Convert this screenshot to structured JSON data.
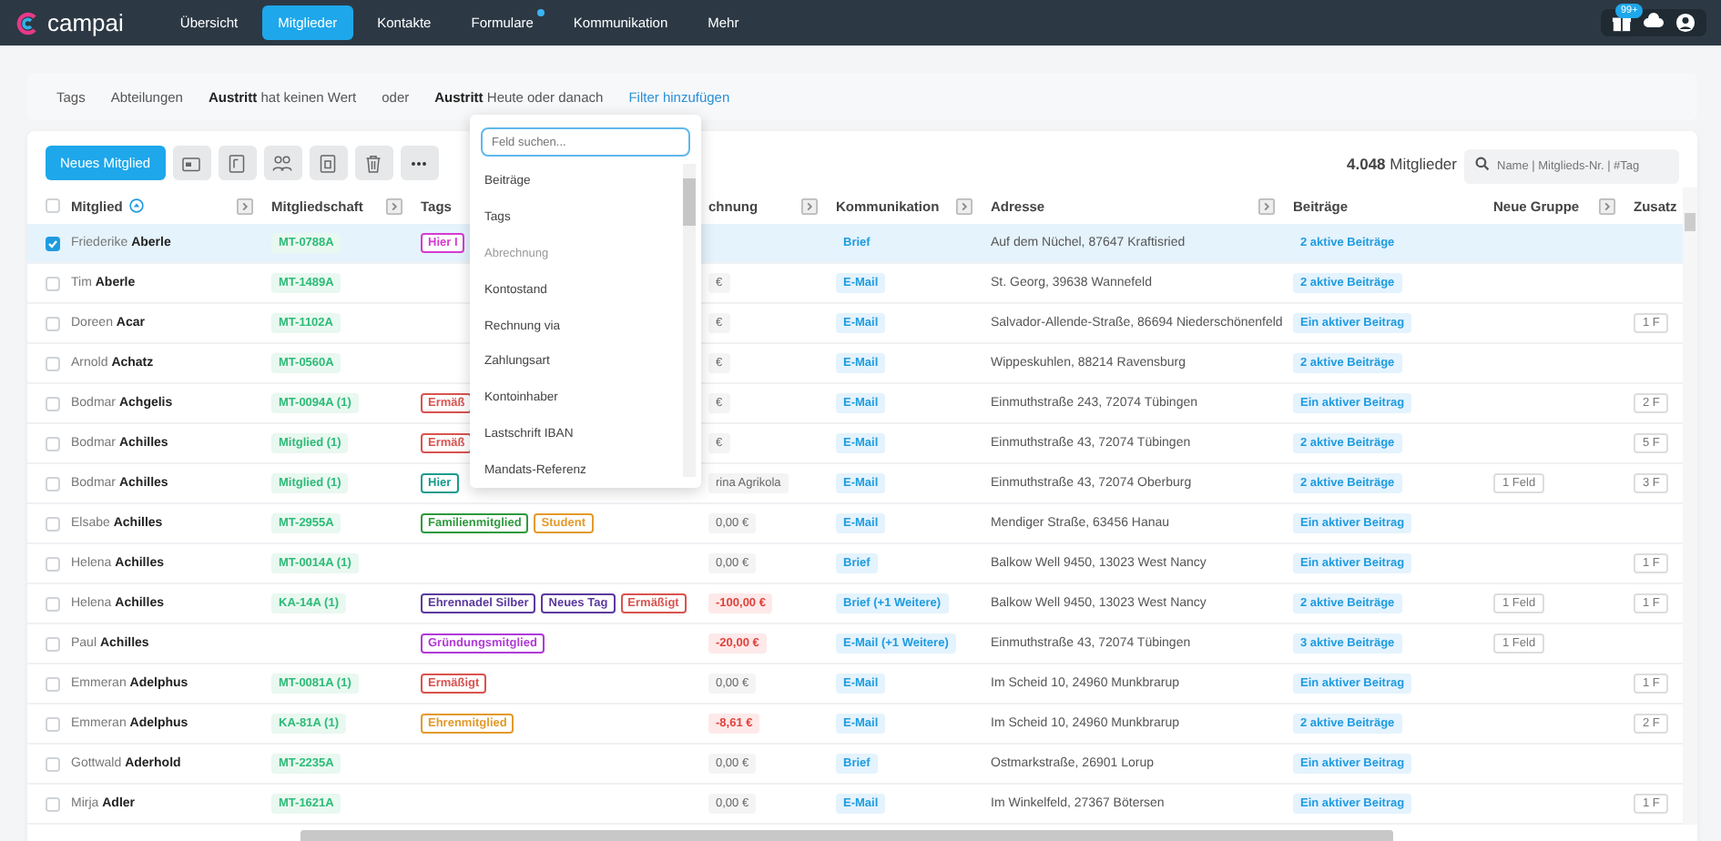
{
  "nav": {
    "logo": "campai",
    "items": [
      {
        "label": "Übersicht",
        "selected": false
      },
      {
        "label": "Mitglieder",
        "selected": true
      },
      {
        "label": "Kontakte",
        "selected": false
      },
      {
        "label": "Formulare",
        "selected": false,
        "dot": true
      },
      {
        "label": "Kommunikation",
        "selected": false
      },
      {
        "label": "Mehr",
        "selected": false
      }
    ],
    "badge": "99+"
  },
  "filters": [
    {
      "text": "Tags",
      "kind": "plain"
    },
    {
      "text": "Abteilungen",
      "kind": "plain"
    },
    {
      "text": "**Austritt** hat keinen Wert",
      "kind": "plain"
    },
    {
      "text": "oder",
      "kind": "plain"
    },
    {
      "text": "**Austritt** Heute oder danach",
      "kind": "plain"
    },
    {
      "text": "Filter hinzufügen",
      "kind": "link"
    }
  ],
  "toolbar": {
    "primary": "Neues Mitglied",
    "tools": [
      {
        "kind": "card"
      },
      {
        "kind": "form"
      },
      {
        "kind": "people"
      },
      {
        "kind": "number"
      },
      {
        "kind": "trash"
      },
      {
        "kind": "more"
      }
    ],
    "count": "**4.048** Mitglieder",
    "search_placeholder": "Name | Mitglieds-Nr. | #Tag"
  },
  "table": {
    "header_checked": false,
    "columns": [
      {
        "label": "Mitglied",
        "sorted": true,
        "expander": true
      },
      {
        "label": "Mitgliedschaft",
        "expander": true
      },
      {
        "label": "Tags"
      },
      {
        "label": "chnung",
        "expander": true
      },
      {
        "label": "Kommunikation",
        "expander": true
      },
      {
        "label": "Adresse",
        "expander": true
      },
      {
        "label": "Beiträge"
      },
      {
        "label": "Neue Gruppe",
        "expander": true
      },
      {
        "label": "Zusatz"
      }
    ],
    "rows": [
      {
        "selected": true,
        "name": "Friederike **Aberle**",
        "membership": "MT-0788A",
        "tags": [
          {
            "text": "Hier I",
            "color": "#d63bd0"
          }
        ],
        "comm": "Brief",
        "address": "Auf dem Nüchel, 87647 Kraftisried",
        "fees": "2 aktive Beiträge"
      },
      {
        "selected": false,
        "name": "Tim **Aberle**",
        "membership": "MT-1489A",
        "tags": [],
        "balance": "€",
        "comm": "E-Mail",
        "address": "St. Georg, 39638 Wannefeld",
        "fees": "2 aktive Beiträge"
      },
      {
        "selected": false,
        "name": "Doreen **Acar**",
        "membership": "MT-1102A",
        "tags": [],
        "balance": "€",
        "comm": "E-Mail",
        "address": "Salvador-Allende-Straße, 86694 Niederschönenfeld",
        "fees": "Ein aktiver Beitrag",
        "extra": "1 F"
      },
      {
        "selected": false,
        "name": "Arnold **Achatz**",
        "membership": "MT-0560A",
        "tags": [],
        "balance": "€",
        "comm": "E-Mail",
        "address": "Wippeskuhlen, 88214 Ravensburg",
        "fees": "2 aktive Beiträge"
      },
      {
        "selected": false,
        "name": "Bodmar **Achgelis**",
        "membership": "MT-0094A (1)",
        "tags": [
          {
            "text": "Ermäß",
            "color": "#d9534f"
          }
        ],
        "balance": "€",
        "comm": "E-Mail",
        "address": "Einmuthstraße 243, 72074 Tübingen",
        "fees": "Ein aktiver Beitrag",
        "extra": "2 F"
      },
      {
        "selected": false,
        "name": "Bodmar **Achilles**",
        "membership": "Mitglied (1)",
        "tags": [
          {
            "text": "Ermäß",
            "color": "#d9534f"
          }
        ],
        "balance": "€",
        "comm": "E-Mail",
        "address": "Einmuthstraße 43, 72074 Tübingen",
        "fees": "2 aktive Beiträge",
        "extra": "5 F"
      },
      {
        "selected": false,
        "name": "Bodmar **Achilles**",
        "membership": "Mitglied (1)",
        "tags": [
          {
            "text": "Hier",
            "color": "#1a9c8c"
          }
        ],
        "balance": "rina Agrikola",
        "comm": "E-Mail",
        "address": "Einmuthstraße 43, 72074 Oberburg",
        "fees": "2 aktive Beiträge",
        "group": "1 Feld",
        "extra": "3 F"
      },
      {
        "selected": false,
        "name": "Elsabe **Achilles**",
        "membership": "MT-2955A",
        "tags": [
          {
            "text": "Familienmitglied",
            "color": "#2e9a3e"
          },
          {
            "text": "Student",
            "color": "#e39a2b"
          }
        ],
        "balance": "0,00 €",
        "comm": "E-Mail",
        "address": "Mendiger Straße, 63456 Hanau",
        "fees": "Ein aktiver Beitrag"
      },
      {
        "selected": false,
        "name": "Helena **Achilles**",
        "membership": "MT-0014A (1)",
        "tags": [],
        "balance": "0,00 €",
        "comm": "Brief",
        "address": "Balkow Well 9450, 13023 West Nancy",
        "fees": "Ein aktiver Beitrag",
        "extra": "1 F"
      },
      {
        "selected": false,
        "name": "Helena **Achilles**",
        "membership": "KA-14A (1)",
        "tags": [
          {
            "text": "Ehrennadel Silber",
            "color": "#5b3a9e"
          },
          {
            "text": "Neues Tag",
            "color": "#5b3a9e"
          },
          {
            "text": "Ermäßigt",
            "color": "#d9534f"
          }
        ],
        "balance": "-100,00 €",
        "negative": true,
        "comm": "Brief (+1 Weitere)",
        "address": "Balkow Well 9450, 13023 West Nancy",
        "fees": "2 aktive Beiträge",
        "group": "1 Feld",
        "extra": "1 F"
      },
      {
        "selected": false,
        "name": "Paul **Achilles**",
        "tags": [
          {
            "text": "Gründungsmitglied",
            "color": "#b03ad6"
          }
        ],
        "balance": "-20,00 €",
        "negative": true,
        "comm": "E-Mail (+1 Weitere)",
        "address": "Einmuthstraße 43, 72074 Tübingen",
        "fees": "3 aktive Beiträge",
        "group": "1 Feld"
      },
      {
        "selected": false,
        "name": "Emmeran **Adelphus**",
        "membership": "MT-0081A (1)",
        "tags": [
          {
            "text": "Ermäßigt",
            "color": "#d9534f"
          }
        ],
        "balance": "0,00 €",
        "comm": "E-Mail",
        "address": "Im Scheid 10, 24960 Munkbrarup",
        "fees": "Ein aktiver Beitrag",
        "extra": "1 F"
      },
      {
        "selected": false,
        "name": "Emmeran **Adelphus**",
        "membership": "KA-81A (1)",
        "tags": [
          {
            "text": "Ehrenmitglied",
            "color": "#e39a2b"
          }
        ],
        "balance": "-8,61 €",
        "negative": true,
        "comm": "E-Mail",
        "address": "Im Scheid 10, 24960 Munkbrarup",
        "fees": "2 aktive Beiträge",
        "extra": "2 F"
      },
      {
        "selected": false,
        "name": "Gottwald **Aderhold**",
        "membership": "MT-2235A",
        "tags": [],
        "balance": "0,00 €",
        "comm": "Brief",
        "address": "Ostmarkstraße, 26901 Lorup",
        "fees": "Ein aktiver Beitrag"
      },
      {
        "selected": false,
        "name": "Mirja **Adler**",
        "membership": "MT-1621A",
        "tags": [],
        "balance": "0,00 €",
        "comm": "E-Mail",
        "address": "Im Winkelfeld, 27367 Bötersen",
        "fees": "Ein aktiver Beitrag",
        "extra": "1 F"
      }
    ]
  },
  "dropdown": {
    "placeholder": "Feld suchen...",
    "items": [
      {
        "text": "Beiträge",
        "kind": "option"
      },
      {
        "text": "Tags",
        "kind": "option"
      },
      {
        "text": "Abrechnung",
        "kind": "group"
      },
      {
        "text": "Kontostand",
        "kind": "option"
      },
      {
        "text": "Rechnung via",
        "kind": "option"
      },
      {
        "text": "Zahlungsart",
        "kind": "option"
      },
      {
        "text": "Kontoinhaber",
        "kind": "option"
      },
      {
        "text": "Lastschrift IBAN",
        "kind": "option"
      },
      {
        "text": "Mandats-Referenz",
        "kind": "option"
      }
    ]
  }
}
